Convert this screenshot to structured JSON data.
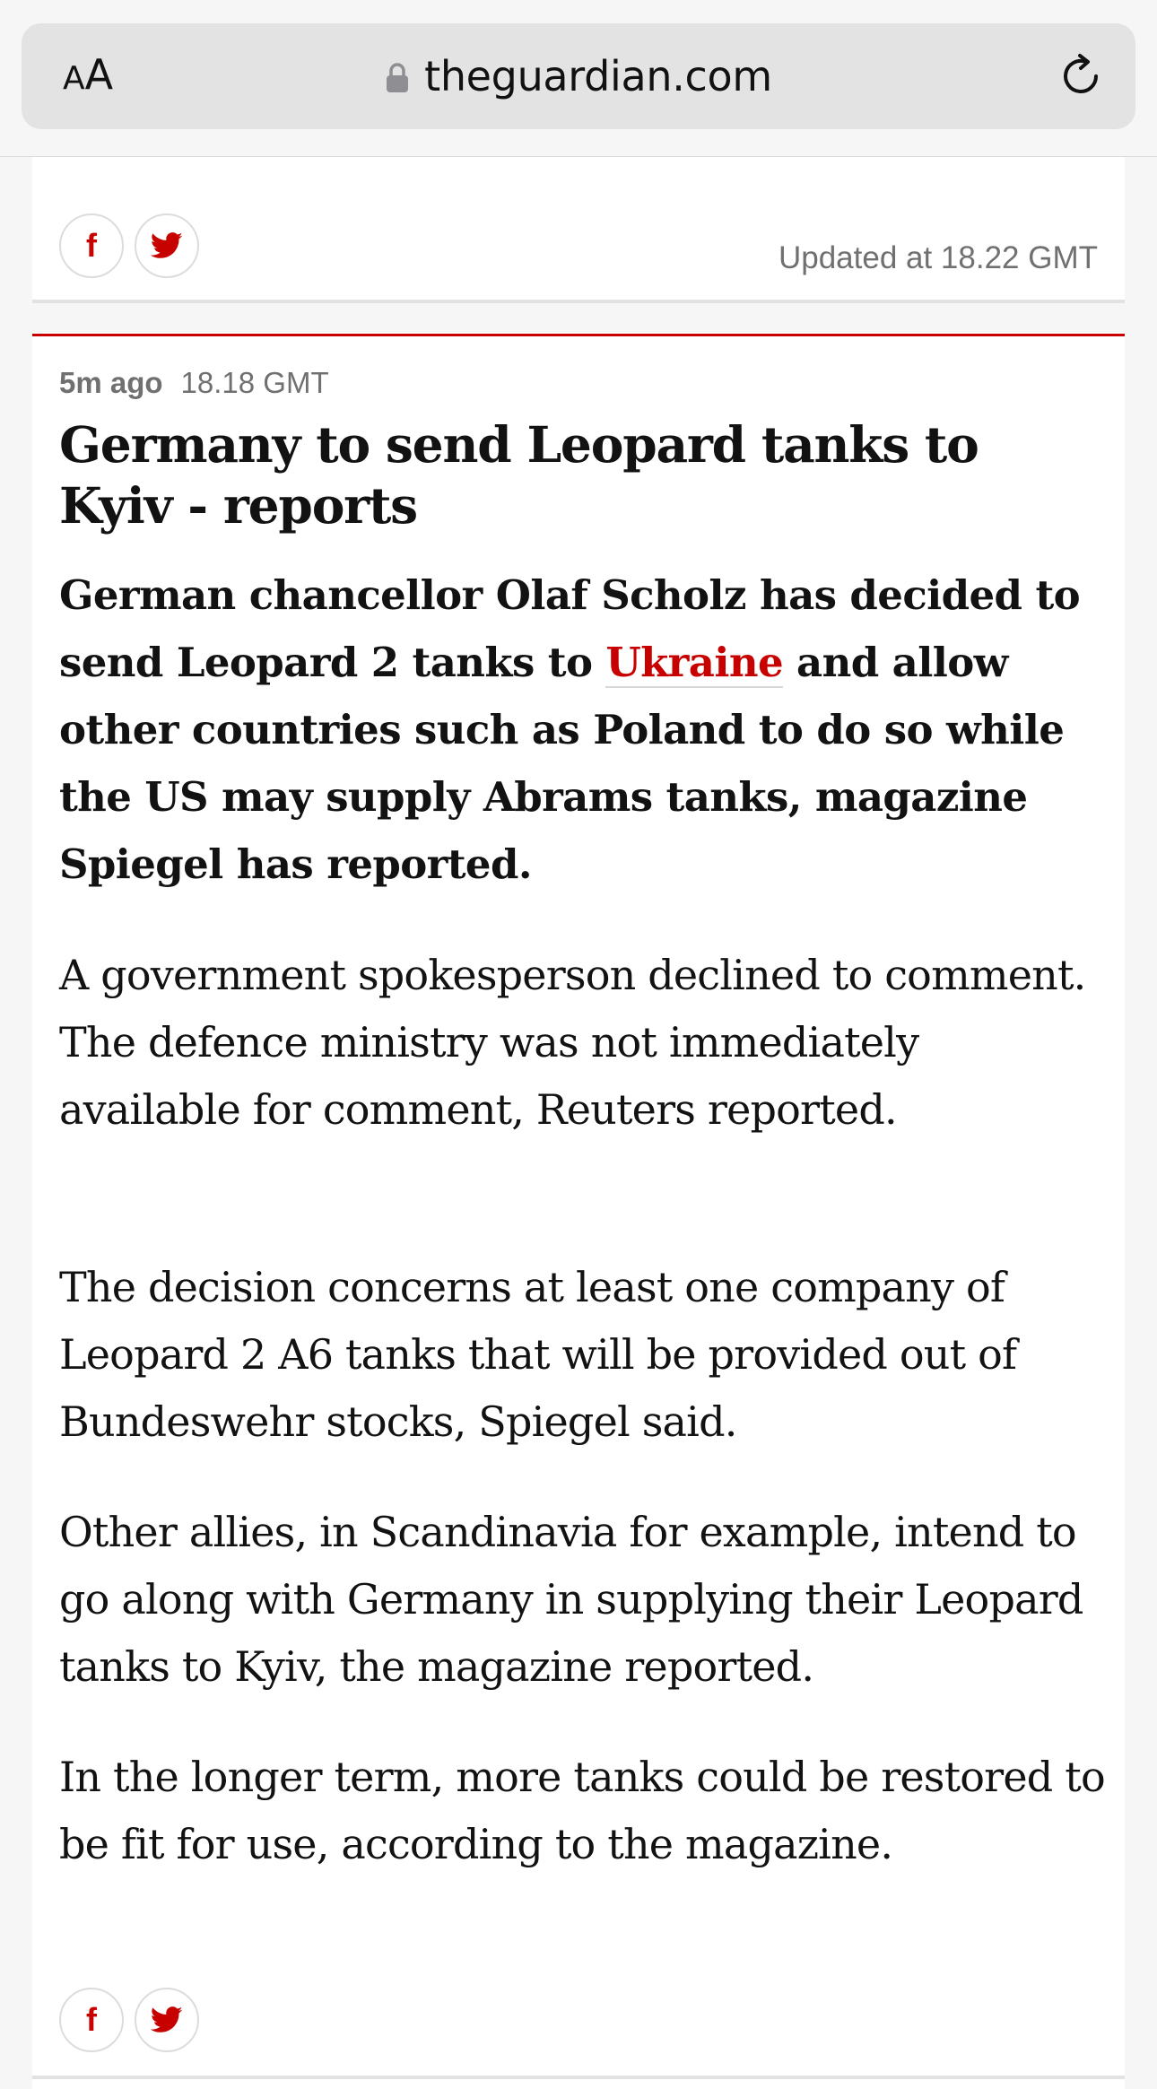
{
  "browser": {
    "text_size_label_small": "A",
    "text_size_label_large": "A",
    "url": "theguardian.com"
  },
  "previous_entry": {
    "updated": "Updated at 18.22 GMT"
  },
  "entry": {
    "time_ago": "5m ago",
    "timestamp": "18.18 GMT",
    "headline": "Germany to send Leopard tanks to Kyiv - reports",
    "standfirst_before": "German chancellor Olaf Scholz has decided to send Leopard 2 tanks to ",
    "standfirst_link": "Ukraine",
    "standfirst_after": " and allow other countries such as Poland to do so while the US may supply Abrams tanks, magazine Spiegel has reported.",
    "paragraphs": [
      "A government spokesperson declined to comment. The defence ministry was not immediately available for comment, Reuters reported.",
      "The decision concerns at least one company of Leopard 2 A6 tanks that will be provided out of Bundeswehr stocks, Spiegel said.",
      "Other allies, in Scandinavia for example, intend to go along with Germany in supplying their Leopard tanks to Kyiv, the magazine reported.",
      "In the longer term, more tanks could be restored to be fit for use, according to the magazine."
    ]
  },
  "share": {
    "facebook_glyph": "f",
    "facebook_icon": "facebook-icon",
    "twitter_icon": "twitter-icon"
  },
  "colors": {
    "accent_red": "#c70000",
    "meta_grey": "#707070",
    "text": "#121212"
  }
}
